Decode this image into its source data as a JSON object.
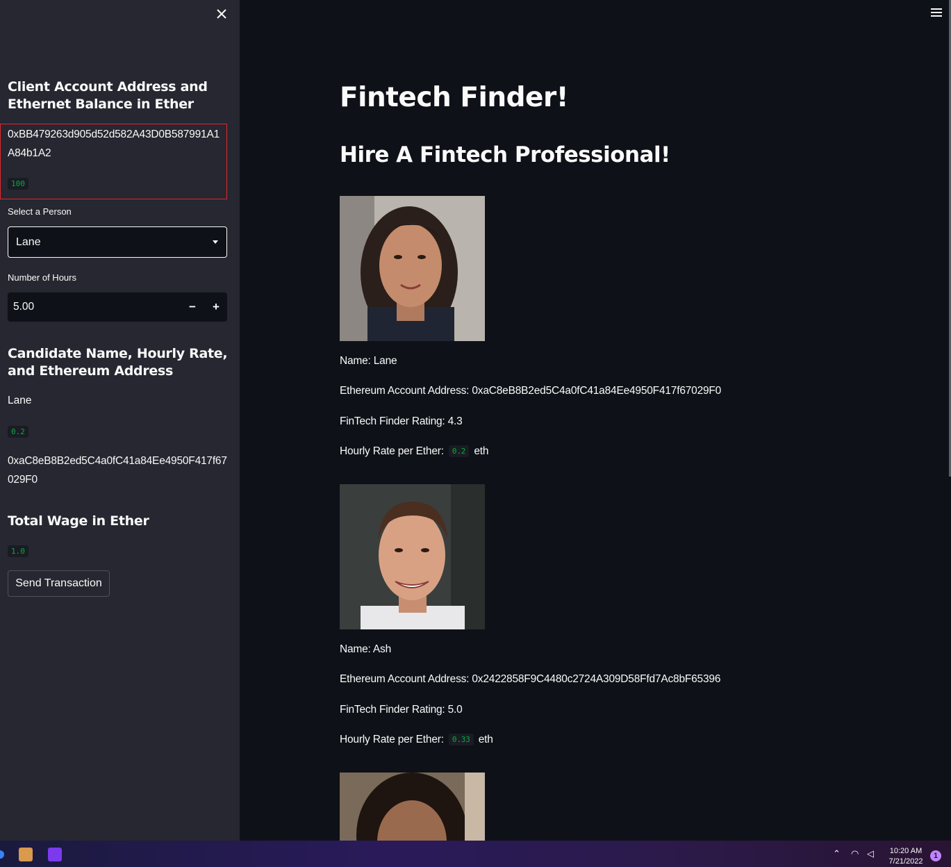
{
  "sidebar": {
    "account_heading": "Client Account Address and Ethernet Balance in Ether",
    "account_address": "0xBB479263d905d52d582A43D0B587991A1A84b1A2",
    "balance": "100",
    "select_label": "Select a Person",
    "selected_person": "Lane",
    "hours_label": "Number of Hours",
    "hours_value": "5.00",
    "candidate_heading": "Candidate Name, Hourly Rate, and Ethereum Address",
    "candidate_name": "Lane",
    "candidate_rate": "0.2",
    "candidate_address": "0xaC8eB8B2ed5C4a0fC41a84Ee4950F417f67029F0",
    "wage_heading": "Total Wage in Ether",
    "wage_value": "1.0",
    "send_button": "Send Transaction",
    "close_icon": "close-icon"
  },
  "main": {
    "title": "Fintech Finder!",
    "subtitle": "Hire A Fintech Professional!",
    "candidates": [
      {
        "name_line": "Name: Lane",
        "address_line": "Ethereum Account Address: 0xaC8eB8B2ed5C4a0fC41a84Ee4950F417f67029F0",
        "rating_line": "FinTech Finder Rating: 4.3",
        "rate_prefix": "Hourly Rate per Ether:",
        "rate_value": "0.2",
        "rate_suffix": "eth"
      },
      {
        "name_line": "Name: Ash",
        "address_line": "Ethereum Account Address: 0x2422858F9C4480c2724A309D58Ffd7Ac8bF65396",
        "rating_line": "FinTech Finder Rating: 5.0",
        "rate_prefix": "Hourly Rate per Ether:",
        "rate_value": "0.33",
        "rate_suffix": "eth"
      }
    ]
  },
  "taskbar": {
    "time": "10:20 AM",
    "date": "7/21/2022",
    "notification_count": "1"
  },
  "colors": {
    "background": "#0e1117",
    "sidebar": "#262730",
    "code_text": "#09ab3b",
    "highlight_border": "#e0282e"
  }
}
